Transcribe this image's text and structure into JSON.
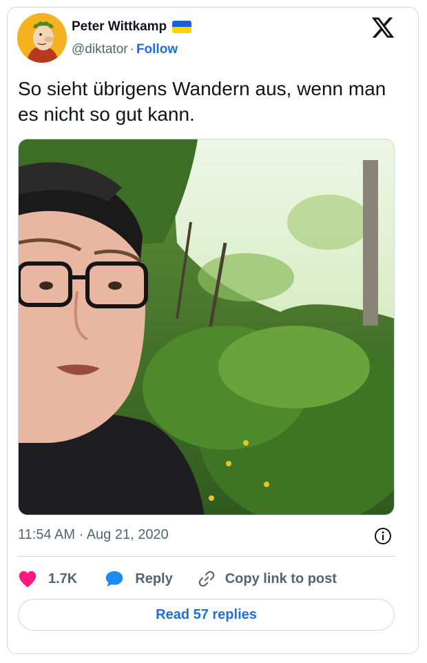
{
  "author": {
    "name": "Peter Wittkamp",
    "handle": "@diktator",
    "separator": "·",
    "follow_label": "Follow",
    "flag": "ukraine-flag"
  },
  "tweet": {
    "text": "So sieht übrigens Wandern aus, wenn man es nicht so gut kann.",
    "timestamp": "11:54 AM · Aug 21, 2020"
  },
  "actions": {
    "like_count": "1.7K",
    "reply_label": "Reply",
    "copy_label": "Copy link to post"
  },
  "read_replies_label": "Read 57 replies",
  "colors": {
    "accent": "#1d6fd6",
    "like": "#f91880",
    "border": "#cfd9de",
    "muted": "#536471"
  }
}
